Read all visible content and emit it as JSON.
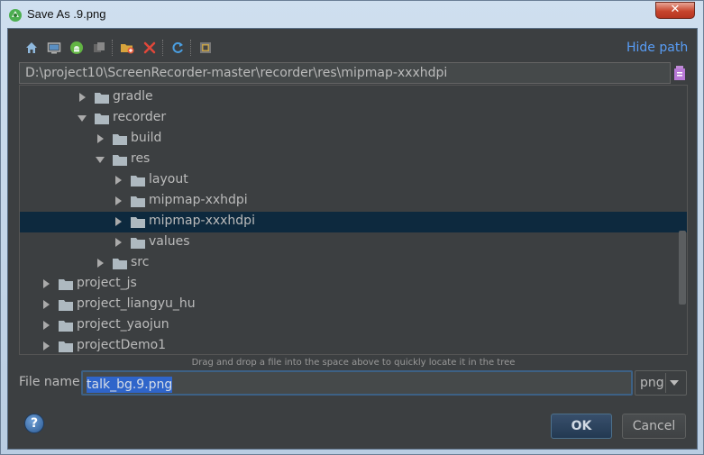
{
  "window": {
    "title": "Save As .9.png",
    "close_label": "✕"
  },
  "toolbar": {
    "icons": [
      "home-icon",
      "desktop-icon",
      "android-project-icon",
      "module-icon",
      "new-folder-icon",
      "delete-icon",
      "refresh-icon",
      "show-hidden-icon"
    ],
    "hide_path_label": "Hide path"
  },
  "path": {
    "value": "D:\\project10\\ScreenRecorder-master\\recorder\\res\\mipmap-xxxhdpi"
  },
  "tree": {
    "items": [
      {
        "label": "gradle",
        "expanded": false
      },
      {
        "label": "recorder",
        "expanded": true
      },
      {
        "label": "build",
        "expanded": false
      },
      {
        "label": "res",
        "expanded": true
      },
      {
        "label": "layout",
        "expanded": false
      },
      {
        "label": "mipmap-xxhdpi",
        "expanded": false
      },
      {
        "label": "mipmap-xxxhdpi",
        "expanded": false,
        "selected": true
      },
      {
        "label": "values",
        "expanded": false
      },
      {
        "label": "src",
        "expanded": false
      },
      {
        "label": "project_js",
        "expanded": false
      },
      {
        "label": "project_liangyu_hu",
        "expanded": false
      },
      {
        "label": "project_yaojun",
        "expanded": false
      },
      {
        "label": "projectDemo1",
        "expanded": false
      }
    ],
    "hint": "Drag and drop a file into the space above to quickly locate it in the tree"
  },
  "file_name": {
    "label": "File name:",
    "value": "talk_bg.9.png"
  },
  "file_type": {
    "selected": "png"
  },
  "buttons": {
    "help_label": "?",
    "ok_label": "OK",
    "cancel_label": "Cancel"
  },
  "colors": {
    "background": "#3c3f41",
    "selection": "#0d293e",
    "link": "#589df6"
  }
}
